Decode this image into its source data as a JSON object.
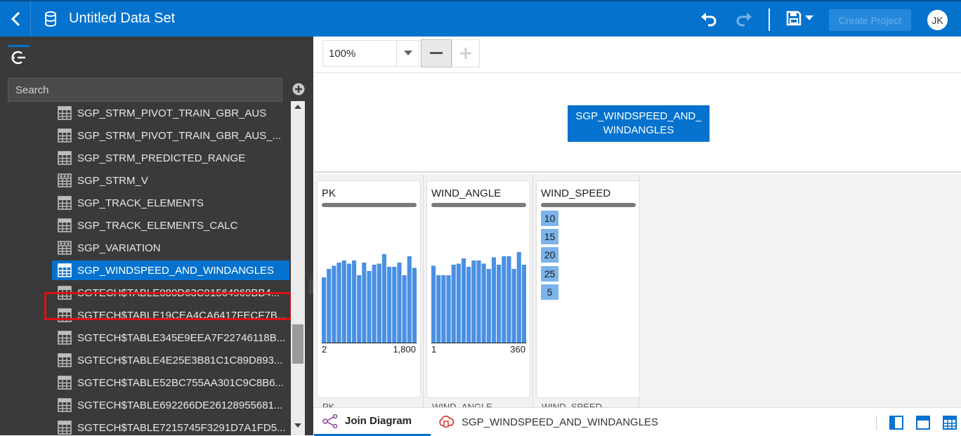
{
  "header": {
    "title": "Untitled Data Set",
    "create_project_label": "Create Project",
    "avatar_initials": "JK",
    "accent_color": "#0572ce"
  },
  "left_panel": {
    "search_placeholder": "Search",
    "items": [
      {
        "label": "SGP_STRM_PIVOT_TRAIN_GBR_AUS",
        "icon": "table-icon"
      },
      {
        "label": "SGP_STRM_PIVOT_TRAIN_GBR_AUS_...",
        "icon": "table-icon"
      },
      {
        "label": "SGP_STRM_PREDICTED_RANGE",
        "icon": "table-icon"
      },
      {
        "label": "SGP_STRM_V",
        "icon": "view-icon"
      },
      {
        "label": "SGP_TRACK_ELEMENTS",
        "icon": "table-icon"
      },
      {
        "label": "SGP_TRACK_ELEMENTS_CALC",
        "icon": "table-icon"
      },
      {
        "label": "SGP_VARIATION",
        "icon": "view-icon"
      },
      {
        "label": "SGP_WINDSPEED_AND_WINDANGLES",
        "icon": "table-icon",
        "selected": true
      },
      {
        "label": "SGTECH$TABLE080D63C91564969BB4...",
        "icon": "table-icon"
      },
      {
        "label": "SGTECH$TABLE19CEA4CA6417FECF7B...",
        "icon": "table-icon"
      },
      {
        "label": "SGTECH$TABLE345E9EEA7F22746118B...",
        "icon": "table-icon"
      },
      {
        "label": "SGTECH$TABLE4E25E3B81C1C89D893...",
        "icon": "table-icon"
      },
      {
        "label": "SGTECH$TABLE52BC755AA301C9C8B6...",
        "icon": "table-icon"
      },
      {
        "label": "SGTECH$TABLE692266DE26128955681...",
        "icon": "table-icon"
      },
      {
        "label": "SGTECH$TABLE7215745F3291D7A1FD5...",
        "icon": "table-icon"
      }
    ]
  },
  "zoom": {
    "level": "100%"
  },
  "diagram": {
    "node_label": "SGP_WINDSPEED_AND_WINDANGLES"
  },
  "columns": [
    {
      "name": "PK",
      "min": "2",
      "max": "1,800",
      "hist": [
        0.62,
        0.7,
        0.73,
        0.76,
        0.78,
        0.75,
        0.78,
        0.64,
        0.76,
        0.68,
        0.74,
        0.75,
        0.84,
        0.72,
        0.72,
        0.76,
        0.64,
        0.82,
        0.71
      ],
      "footer": "PK"
    },
    {
      "name": "WIND_ANGLE",
      "min": "1",
      "max": "360",
      "hist": [
        0.73,
        0.64,
        0.64,
        0.64,
        0.74,
        0.75,
        0.8,
        0.72,
        0.78,
        0.78,
        0.75,
        0.7,
        0.81,
        0.74,
        0.82,
        0.82,
        0.7,
        0.86,
        0.74
      ],
      "footer": "WIND_ANGLE"
    },
    {
      "name": "WIND_SPEED",
      "values": [
        "10",
        "15",
        "20",
        "25",
        "5"
      ],
      "footer": "WIND_SPEED"
    }
  ],
  "bottom_tabs": {
    "join_diagram": "Join Diagram",
    "dataset_tab": "SGP_WINDSPEED_AND_WINDANGLES"
  }
}
